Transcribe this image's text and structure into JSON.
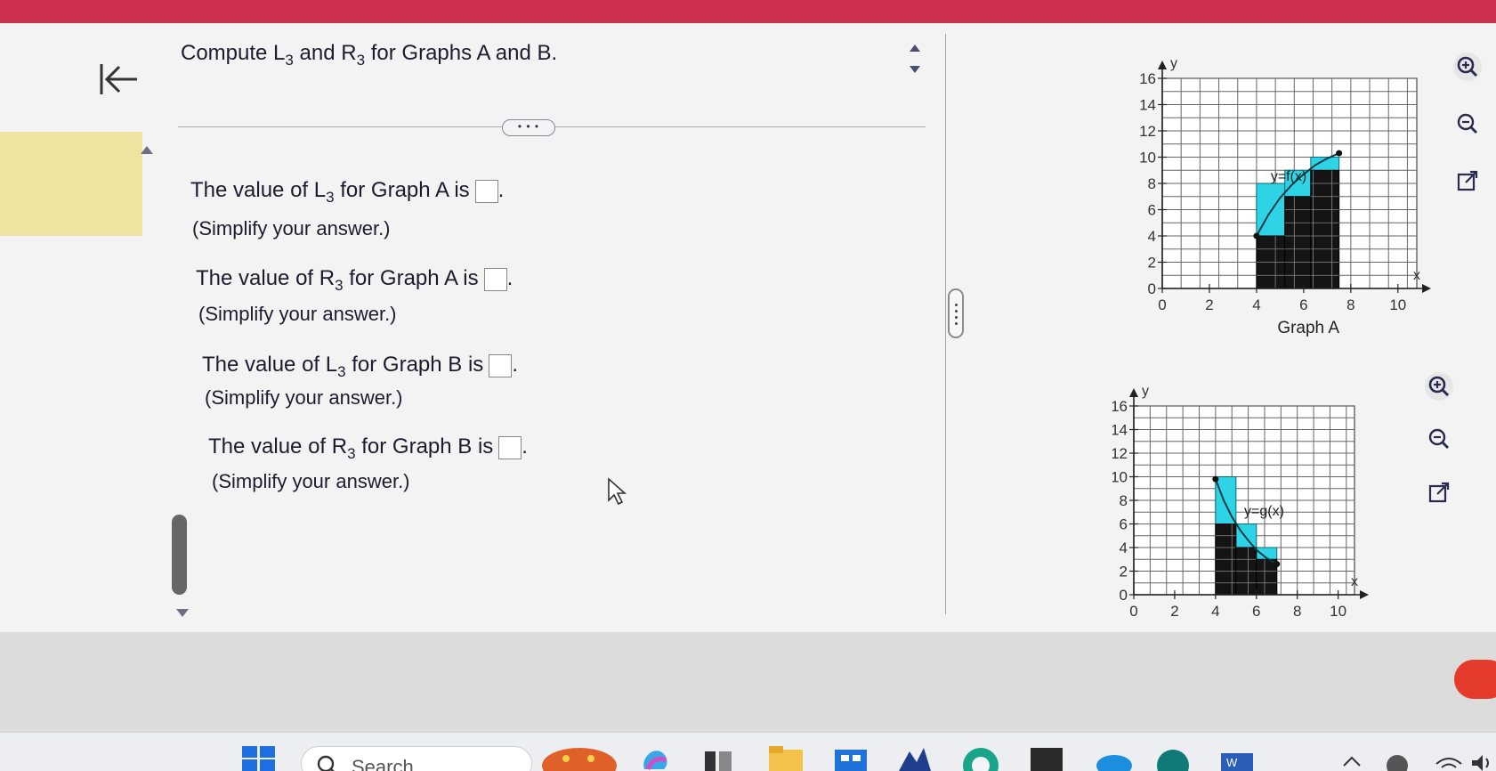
{
  "question": {
    "prompt_pre": "Compute L",
    "prompt_sub1": "3",
    "prompt_mid": " and R",
    "prompt_sub2": "3",
    "prompt_post": " for Graphs A and B.",
    "more_label": "• • •"
  },
  "answers": [
    {
      "pre": "The value of L",
      "sub": "3",
      "post": " for Graph A is",
      "value": "",
      "hint": "(Simplify your answer.)"
    },
    {
      "pre": "The value of R",
      "sub": "3",
      "post": " for Graph A is",
      "value": "",
      "hint": "(Simplify your answer.)"
    },
    {
      "pre": "The value of L",
      "sub": "3",
      "post": " for Graph B is",
      "value": "",
      "hint": "(Simplify your answer.)"
    },
    {
      "pre": "The value of R",
      "sub": "3",
      "post": " for Graph B is",
      "value": "",
      "hint": "(Simplify your answer.)"
    }
  ],
  "graph_a": {
    "caption": "Graph A",
    "curve_label": "y=f(x)",
    "x_axis_label": "x",
    "y_axis_label": "y",
    "x_ticks": [
      "0",
      "2",
      "4",
      "6",
      "8",
      "10"
    ],
    "y_ticks": [
      "0",
      "2",
      "4",
      "6",
      "8",
      "10",
      "12",
      "14",
      "16"
    ]
  },
  "graph_b": {
    "curve_label": "y=g(x)",
    "x_axis_label": "x",
    "y_axis_label": "y",
    "x_ticks": [
      "0",
      "2",
      "4",
      "6",
      "8",
      "10"
    ],
    "y_ticks": [
      "0",
      "2",
      "4",
      "6",
      "8",
      "10",
      "12",
      "14",
      "16"
    ]
  },
  "chart_data": [
    {
      "type": "area",
      "title": "Graph A",
      "xlabel": "x",
      "ylabel": "y",
      "xlim": [
        0,
        10.8
      ],
      "ylim": [
        0,
        16
      ],
      "curve": {
        "name": "y=f(x)",
        "x": [
          4,
          4.5,
          5,
          5.5,
          6,
          6.5,
          7,
          7.5
        ],
        "y": [
          4,
          5.6,
          6.9,
          7.9,
          8.7,
          9.4,
          9.9,
          10.3
        ]
      },
      "left_rects": [
        {
          "x0": 4,
          "x1": 5.2,
          "y": 4
        },
        {
          "x0": 5.2,
          "x1": 6.3,
          "y": 7
        },
        {
          "x0": 6.3,
          "x1": 7.5,
          "y": 9
        }
      ],
      "right_rects": [
        {
          "x0": 4,
          "x1": 5.2,
          "y": 8
        },
        {
          "x0": 5.2,
          "x1": 6.3,
          "y": 9
        },
        {
          "x0": 6.3,
          "x1": 7.5,
          "y": 10
        }
      ],
      "grid": true
    },
    {
      "type": "area",
      "title": "",
      "xlabel": "x",
      "ylabel": "y",
      "xlim": [
        0,
        10.8
      ],
      "ylim": [
        0,
        16
      ],
      "curve": {
        "name": "y=g(x)",
        "x": [
          4,
          4.4,
          4.8,
          5.2,
          5.6,
          6,
          6.5,
          7
        ],
        "y": [
          9.8,
          8,
          6.6,
          5.5,
          4.6,
          3.8,
          3.1,
          2.6
        ]
      },
      "left_rects": [
        {
          "x0": 4,
          "x1": 5,
          "y": 10
        },
        {
          "x0": 5,
          "x1": 6,
          "y": 6
        },
        {
          "x0": 6,
          "x1": 7,
          "y": 4
        }
      ],
      "right_rects": [
        {
          "x0": 4,
          "x1": 5,
          "y": 6
        },
        {
          "x0": 5,
          "x1": 6,
          "y": 4
        },
        {
          "x0": 6,
          "x1": 7,
          "y": 3
        }
      ],
      "grid": true
    }
  ],
  "taskbar": {
    "search_label": "Search"
  },
  "colors": {
    "accent_bar": "#cd3050",
    "cyan_fill": "#2ed4e6",
    "highlight": "#efe3a0"
  }
}
